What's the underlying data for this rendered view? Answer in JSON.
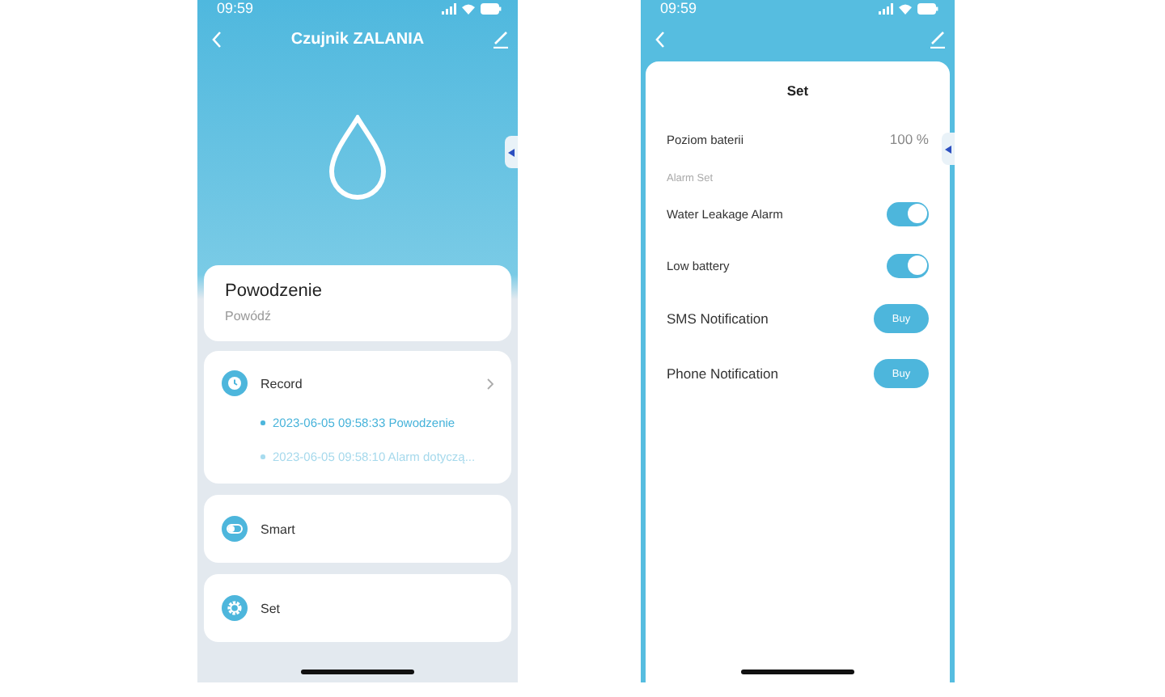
{
  "left_screen": {
    "status_bar": {
      "time": "09:59"
    },
    "title": "Czujnik ZALANIA",
    "status_card": {
      "title": "Powodzenie",
      "subtitle": "Powódź"
    },
    "record_card": {
      "label": "Record",
      "entries": [
        {
          "text": "2023-06-05 09:58:33 Powodzenie",
          "highlighted": true
        },
        {
          "text": "2023-06-05 09:58:10 Alarm dotyczą...",
          "highlighted": false
        }
      ]
    },
    "menu": [
      {
        "kind": "smart",
        "label": "Smart"
      },
      {
        "kind": "set",
        "label": "Set"
      }
    ]
  },
  "right_screen": {
    "status_bar": {
      "time": "09:59"
    },
    "title": "Set",
    "rows": [
      {
        "kind": "value",
        "label": "Poziom baterii",
        "value": "100 %"
      },
      {
        "kind": "section",
        "label": "Alarm Set"
      },
      {
        "kind": "toggle",
        "label": "Water Leakage Alarm",
        "on": true
      },
      {
        "kind": "toggle",
        "label": "Low battery",
        "on": true
      },
      {
        "kind": "button",
        "label": "SMS Notification",
        "button": "Buy"
      },
      {
        "kind": "button",
        "label": "Phone Notification",
        "button": "Buy"
      }
    ]
  }
}
